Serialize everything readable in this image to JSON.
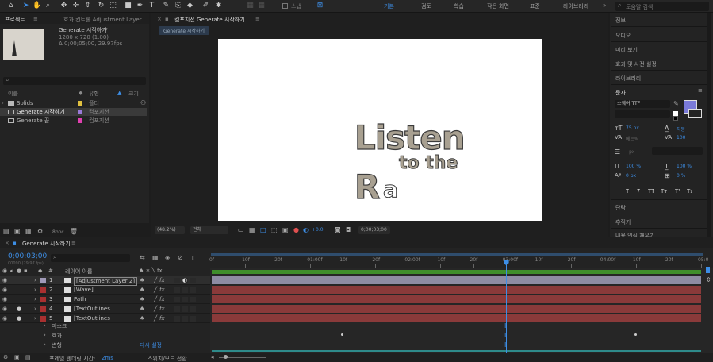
{
  "toolbar": {
    "workspaces": [
      "기본",
      "검토",
      "학습",
      "작은 화면",
      "표준",
      "라이브러리"
    ],
    "active_workspace": "기본",
    "snap_label": "스냅",
    "search_placeholder": "도움말 검색"
  },
  "project": {
    "tab_label": "프로젝트",
    "effects_tab": "효과 컨트롤 Adjustment Layer",
    "item_name": "Generate 시작하기",
    "item_info_1": "1280 x 720 (1.00)",
    "item_info_2": "Δ 0;00;05;00, 29.97fps",
    "col_name": "이름",
    "col_type": "유형",
    "col_size": "크기",
    "items": [
      {
        "name": "Solids",
        "type": "폴더",
        "color": "#e0c040"
      },
      {
        "name": "Generate 시작하기",
        "type": "컴포지션",
        "color": "#9a7ad8"
      },
      {
        "name": "Generate 끝",
        "type": "컴포지션",
        "color": "#e040b0"
      }
    ],
    "bpc": "8bpc"
  },
  "comp": {
    "tab_label": "컴포지션 Generate 시작하기",
    "subtab": "Generate 시작하기",
    "text_line1": "Listen",
    "text_line2": "to the",
    "text_line3": "R",
    "text_partial": "a",
    "zoom": "(48.2%)",
    "quality": "전체",
    "exposure": "+0.0",
    "timecode": "0;00;03;00"
  },
  "right": {
    "items": [
      "정보",
      "오디오",
      "미리 보기",
      "효과 및 사전 설정",
      "라이브러리"
    ],
    "char_title": "문자",
    "font_name": "스퀘어 TTF",
    "size_label": "75 px",
    "leading_label": "자동",
    "kerning_label": "메트릭",
    "tracking_label": "100",
    "stroke_label": "- px",
    "vscale": "100 %",
    "hscale": "100 %",
    "baseline": "0 px",
    "tsume": "0 %",
    "style_buttons": [
      "T",
      "T",
      "TT",
      "Tт",
      "T¹",
      "T₁"
    ],
    "paragraph": "단락",
    "tracker": "추적기",
    "content_aware": "내용 인식 채우기"
  },
  "timeline": {
    "tab_label": "Generate 시작하기",
    "timecode": "0;00;03;00",
    "fps_info": "00090 (29.97 fps)",
    "col_layer_name": "레이어 이름",
    "layers": [
      {
        "num": "1",
        "name": "[Adjustment Layer 2]",
        "color": "#a09ab8"
      },
      {
        "num": "2",
        "name": "[Wave]",
        "color": "#a83030"
      },
      {
        "num": "3",
        "name": "Path",
        "color": "#a83030"
      },
      {
        "num": "4",
        "name": "[TextOutlines",
        "color": "#a83030"
      },
      {
        "num": "5",
        "name": "[TextOutlines",
        "color": "#a83030"
      }
    ],
    "sub_rows": [
      "마스크",
      "효과",
      "변형"
    ],
    "reset_label": "다시 설정",
    "ruler": [
      "0f",
      "10f",
      "20f",
      "01:00f",
      "10f",
      "20f",
      "02:00f",
      "10f",
      "20f",
      "03:00f",
      "10f",
      "20f",
      "04:00f",
      "10f",
      "20f",
      "05:0"
    ],
    "footer_render": "프레임 렌더링 시간:",
    "footer_render_val": "2ms",
    "footer_switch": "스위치/모드 전환",
    "playhead_fraction": 0.6
  }
}
